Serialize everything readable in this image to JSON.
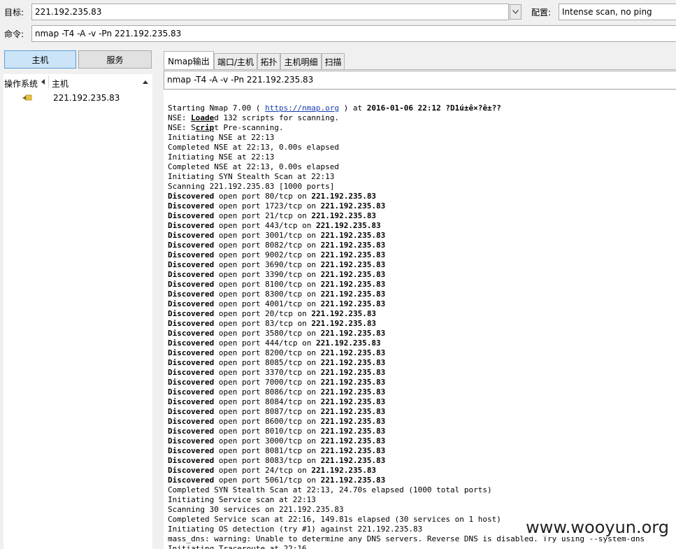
{
  "toolbar": {
    "target_label": "目标:",
    "target_value": "221.192.235.83",
    "profile_label": "配置:",
    "profile_value": "Intense scan, no ping",
    "command_label": "命令:",
    "command_value": "nmap -T4 -A -v -Pn 221.192.235.83"
  },
  "sidebar": {
    "hosts_button": "主机",
    "services_button": "服务",
    "col_os": "操作系统",
    "col_host": "主机",
    "hosts": [
      {
        "host": "221.192.235.83"
      }
    ]
  },
  "tabs": [
    {
      "label": "Nmap输出",
      "active": true
    },
    {
      "label": "端口/主机",
      "active": false
    },
    {
      "label": "拓扑",
      "active": false
    },
    {
      "label": "主机明细",
      "active": false
    },
    {
      "label": "扫描",
      "active": false
    }
  ],
  "output": {
    "command_select": "nmap -T4 -A -v -Pn 221.192.235.83",
    "start_prefix": "Starting Nmap 7.00 ( ",
    "start_link": "https://nmap.org",
    "start_mid": " ) at ",
    "start_time": "2016-01-06 22:12",
    "start_suffix": " ?D1ú±ê×?ê±??",
    "line_nse1_a": "NSE: ",
    "line_nse1_b": "Loade",
    "line_nse1_c": "d 132 scripts for scanning.",
    "line_nse2_a": "NSE: S",
    "line_nse2_b": "crip",
    "line_nse2_c": "t Pre-scanning.",
    "pre_lines": [
      "Initiating NSE at 22:13",
      "Completed NSE at 22:13, 0.00s elapsed",
      "Initiating NSE at 22:13",
      "Completed NSE at 22:13, 0.00s elapsed",
      "Initiating SYN Stealth Scan at 22:13",
      "Scanning 221.192.235.83 [1000 ports]"
    ],
    "discovered_word": "Discovered",
    "open_port": " open port ",
    "on_word": " on ",
    "target_ip": "221.192.235.83",
    "ports": [
      "80/tcp",
      "1723/tcp",
      "21/tcp",
      "443/tcp",
      "3001/tcp",
      "8082/tcp",
      "9002/tcp",
      "3690/tcp",
      "3390/tcp",
      "8100/tcp",
      "8300/tcp",
      "4001/tcp",
      "20/tcp",
      "83/tcp",
      "3580/tcp",
      "444/tcp",
      "8200/tcp",
      "8085/tcp",
      "3370/tcp",
      "7000/tcp",
      "8086/tcp",
      "8084/tcp",
      "8087/tcp",
      "8600/tcp",
      "8010/tcp",
      "3000/tcp",
      "8081/tcp",
      "8083/tcp",
      "24/tcp",
      "5061/tcp"
    ],
    "post_lines": [
      "Completed SYN Stealth Scan at 22:13, 24.70s elapsed (1000 total ports)",
      "Initiating Service scan at 22:13",
      "Scanning 30 services on 221.192.235.83",
      "Completed Service scan at 22:16, 149.81s elapsed (30 services on 1 host)",
      "Initiating OS detection (try #1) against 221.192.235.83",
      "mass_dns: warning: Unable to determine any DNS servers. Reverse DNS is disabled. Try using --system-dns",
      "Initiating Traceroute at 22:16"
    ]
  },
  "watermark": "www.wooyun.org"
}
